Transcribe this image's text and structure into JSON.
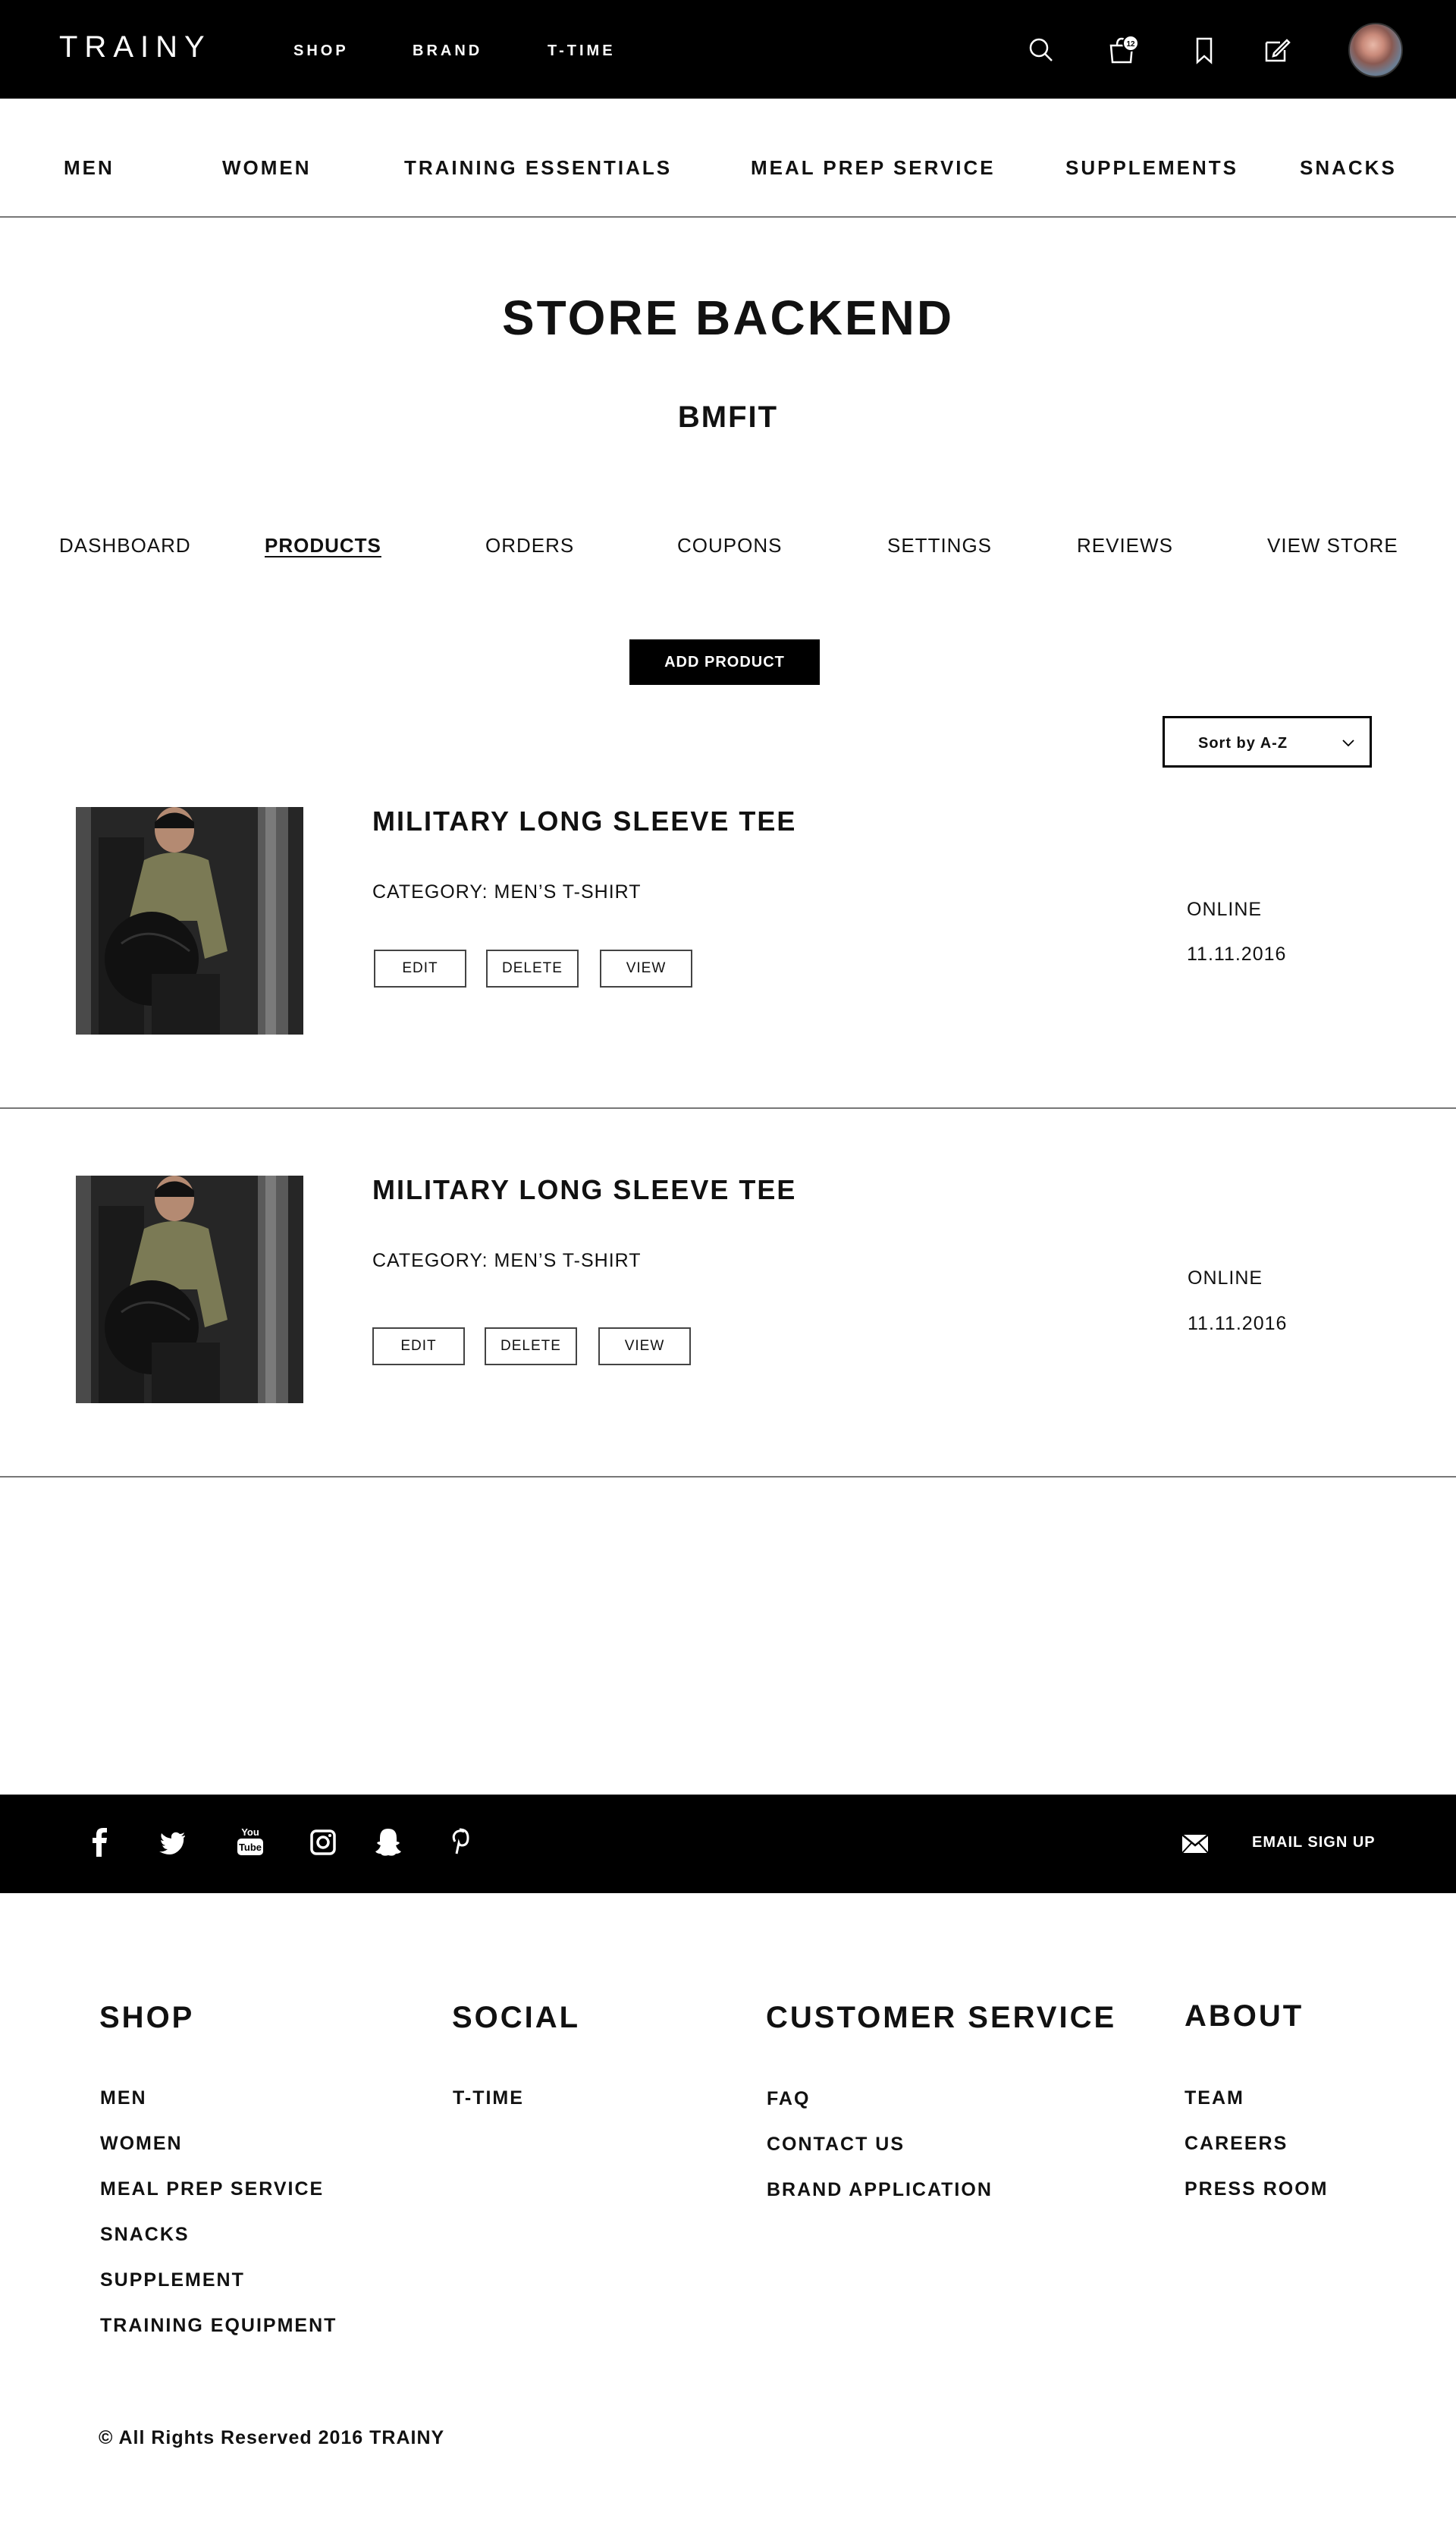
{
  "header": {
    "logo": "TRAINY",
    "nav": [
      "SHOP",
      "BRAND",
      "T-TIME"
    ],
    "cart_count": "12"
  },
  "categories": [
    "MEN",
    "WOMEN",
    "TRAINING ESSENTIALS",
    "MEAL PREP SERVICE",
    "SUPPLEMENTS",
    "SNACKS"
  ],
  "page": {
    "title": "STORE BACKEND",
    "store_name": "BMFIT"
  },
  "tabs": [
    {
      "label": "DASHBOARD",
      "active": false
    },
    {
      "label": "PRODUCTS",
      "active": true
    },
    {
      "label": "ORDERS",
      "active": false
    },
    {
      "label": "COUPONS",
      "active": false
    },
    {
      "label": "SETTINGS",
      "active": false
    },
    {
      "label": "REVIEWS",
      "active": false
    },
    {
      "label": "VIEW STORE",
      "active": false
    }
  ],
  "actions": {
    "add_product": "ADD  PRODUCT",
    "sort_label": "Sort by A-Z"
  },
  "products": [
    {
      "title": "MILITARY LONG SLEEVE TEE",
      "category": "CATEGORY: MEN’S T-SHIRT",
      "status": "ONLINE",
      "date": "11.11.2016",
      "buttons": {
        "edit": "EDIT",
        "delete": "DELETE",
        "view": "VIEW"
      }
    },
    {
      "title": "MILITARY LONG SLEEVE TEE",
      "category": "CATEGORY: MEN’S T-SHIRT",
      "status": "ONLINE",
      "date": "11.11.2016",
      "buttons": {
        "edit": "EDIT",
        "delete": "DELETE",
        "view": "VIEW"
      }
    }
  ],
  "footer": {
    "social_icons": [
      "facebook-icon",
      "twitter-icon",
      "youtube-icon",
      "instagram-icon",
      "snapchat-icon",
      "pinterest-icon"
    ],
    "email_signup": "EMAIL SIGN UP",
    "columns": [
      {
        "title": "SHOP",
        "links": [
          "MEN",
          "WOMEN",
          "MEAL PREP SERVICE",
          "SNACKS",
          "SUPPLEMENT",
          "TRAINING EQUIPMENT"
        ]
      },
      {
        "title": "SOCIAL",
        "links": [
          "T-TIME"
        ]
      },
      {
        "title": "CUSTOMER SERVICE",
        "links": [
          "FAQ",
          "CONTACT US",
          "BRAND APPLICATION"
        ]
      },
      {
        "title": "ABOUT",
        "links": [
          "TEAM",
          "CAREERS",
          "PRESS ROOM"
        ]
      }
    ],
    "copyright": "© All Rights Reserved 2016 TRAINY"
  }
}
